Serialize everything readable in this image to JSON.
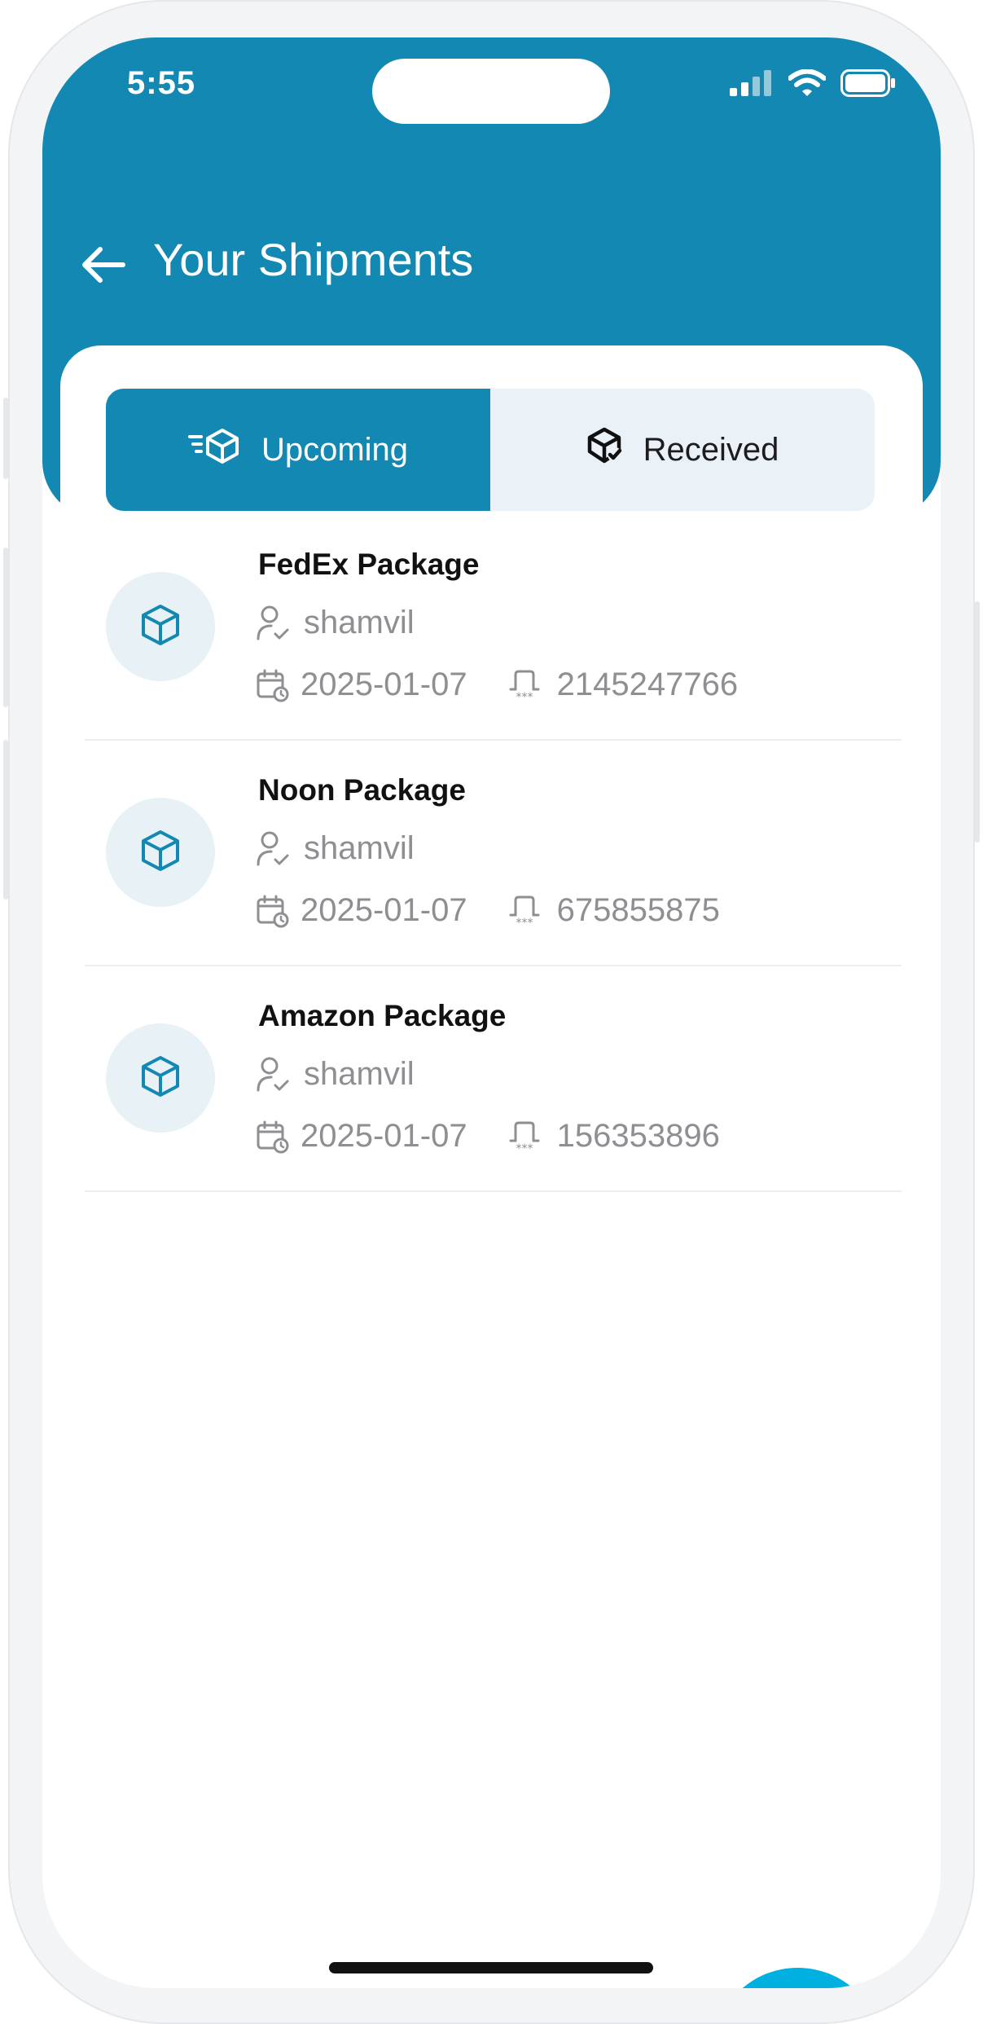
{
  "status_bar": {
    "time": "5:55"
  },
  "header": {
    "title": "Your Shipments",
    "back_icon": "arrow-left-icon"
  },
  "tabs": [
    {
      "label": "Upcoming",
      "icon": "fast-package-icon",
      "active": true
    },
    {
      "label": "Received",
      "icon": "package-check-icon",
      "active": false
    }
  ],
  "shipments": [
    {
      "title": "FedEx Package",
      "user": "shamvil",
      "date": "2025-01-07",
      "tracking": "2145247766"
    },
    {
      "title": "Noon Package",
      "user": "shamvil",
      "date": "2025-01-07",
      "tracking": "675855875"
    },
    {
      "title": "Amazon Package",
      "user": "shamvil",
      "date": "2025-01-07",
      "tracking": "156353896"
    }
  ],
  "fab": {
    "icon": "plus-icon"
  },
  "colors": {
    "primary": "#1288b2",
    "fab": "#00b0e0",
    "tab_inactive_bg": "#eaf2f8",
    "muted_text": "#8e8e93"
  }
}
